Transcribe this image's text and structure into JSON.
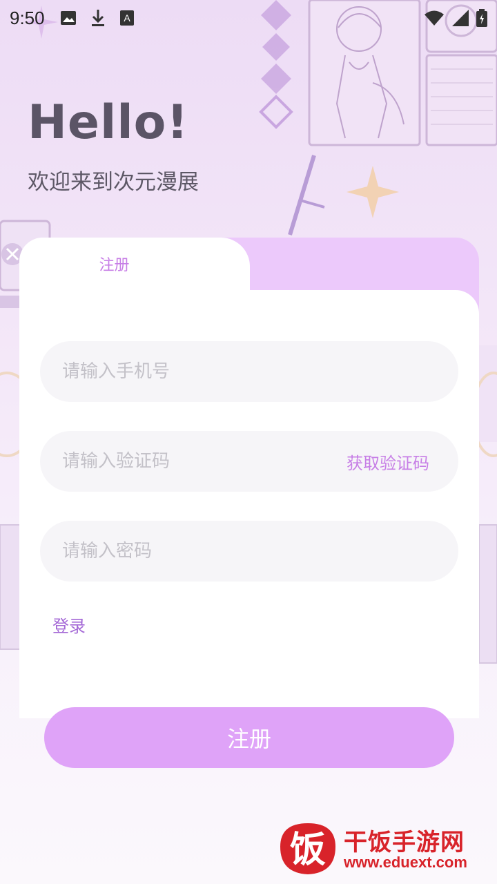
{
  "status_bar": {
    "time": "9:50",
    "left_icons": [
      "image-icon",
      "download-icon",
      "font-icon"
    ],
    "right_icons": [
      "wifi-icon",
      "signal-icon",
      "battery-icon"
    ]
  },
  "header": {
    "greeting": "Hello!",
    "welcome_text": "欢迎来到次元漫展"
  },
  "card": {
    "active_tab": "注册",
    "phone_placeholder": "请输入手机号",
    "code_placeholder": "请输入验证码",
    "get_code_label": "获取验证码",
    "password_placeholder": "请输入密码",
    "login_link": "登录",
    "register_button": "注册"
  },
  "watermark": {
    "logo_char": "饭",
    "name": "干饭手游网",
    "url": "www.eduext.com"
  },
  "colors": {
    "accent": "#c77ee6",
    "button": "#dfa3f8",
    "tab_inactive": "#ecc9fb",
    "watermark": "#d8232a"
  }
}
